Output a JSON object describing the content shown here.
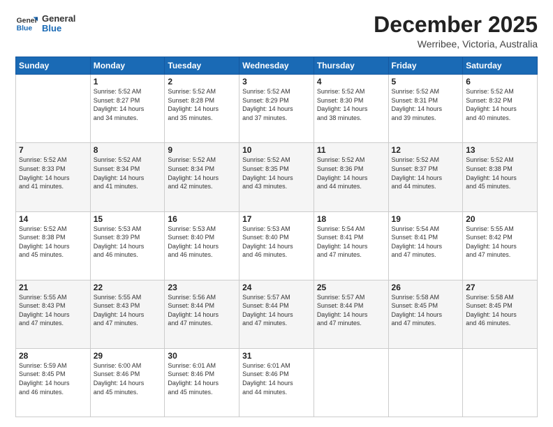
{
  "header": {
    "logo_line1": "General",
    "logo_line2": "Blue",
    "month": "December 2025",
    "location": "Werribee, Victoria, Australia"
  },
  "days_of_week": [
    "Sunday",
    "Monday",
    "Tuesday",
    "Wednesday",
    "Thursday",
    "Friday",
    "Saturday"
  ],
  "weeks": [
    [
      {
        "day": "",
        "info": ""
      },
      {
        "day": "1",
        "info": "Sunrise: 5:52 AM\nSunset: 8:27 PM\nDaylight: 14 hours\nand 34 minutes."
      },
      {
        "day": "2",
        "info": "Sunrise: 5:52 AM\nSunset: 8:28 PM\nDaylight: 14 hours\nand 35 minutes."
      },
      {
        "day": "3",
        "info": "Sunrise: 5:52 AM\nSunset: 8:29 PM\nDaylight: 14 hours\nand 37 minutes."
      },
      {
        "day": "4",
        "info": "Sunrise: 5:52 AM\nSunset: 8:30 PM\nDaylight: 14 hours\nand 38 minutes."
      },
      {
        "day": "5",
        "info": "Sunrise: 5:52 AM\nSunset: 8:31 PM\nDaylight: 14 hours\nand 39 minutes."
      },
      {
        "day": "6",
        "info": "Sunrise: 5:52 AM\nSunset: 8:32 PM\nDaylight: 14 hours\nand 40 minutes."
      }
    ],
    [
      {
        "day": "7",
        "info": "Sunrise: 5:52 AM\nSunset: 8:33 PM\nDaylight: 14 hours\nand 41 minutes."
      },
      {
        "day": "8",
        "info": "Sunrise: 5:52 AM\nSunset: 8:34 PM\nDaylight: 14 hours\nand 41 minutes."
      },
      {
        "day": "9",
        "info": "Sunrise: 5:52 AM\nSunset: 8:34 PM\nDaylight: 14 hours\nand 42 minutes."
      },
      {
        "day": "10",
        "info": "Sunrise: 5:52 AM\nSunset: 8:35 PM\nDaylight: 14 hours\nand 43 minutes."
      },
      {
        "day": "11",
        "info": "Sunrise: 5:52 AM\nSunset: 8:36 PM\nDaylight: 14 hours\nand 44 minutes."
      },
      {
        "day": "12",
        "info": "Sunrise: 5:52 AM\nSunset: 8:37 PM\nDaylight: 14 hours\nand 44 minutes."
      },
      {
        "day": "13",
        "info": "Sunrise: 5:52 AM\nSunset: 8:38 PM\nDaylight: 14 hours\nand 45 minutes."
      }
    ],
    [
      {
        "day": "14",
        "info": "Sunrise: 5:52 AM\nSunset: 8:38 PM\nDaylight: 14 hours\nand 45 minutes."
      },
      {
        "day": "15",
        "info": "Sunrise: 5:53 AM\nSunset: 8:39 PM\nDaylight: 14 hours\nand 46 minutes."
      },
      {
        "day": "16",
        "info": "Sunrise: 5:53 AM\nSunset: 8:40 PM\nDaylight: 14 hours\nand 46 minutes."
      },
      {
        "day": "17",
        "info": "Sunrise: 5:53 AM\nSunset: 8:40 PM\nDaylight: 14 hours\nand 46 minutes."
      },
      {
        "day": "18",
        "info": "Sunrise: 5:54 AM\nSunset: 8:41 PM\nDaylight: 14 hours\nand 47 minutes."
      },
      {
        "day": "19",
        "info": "Sunrise: 5:54 AM\nSunset: 8:41 PM\nDaylight: 14 hours\nand 47 minutes."
      },
      {
        "day": "20",
        "info": "Sunrise: 5:55 AM\nSunset: 8:42 PM\nDaylight: 14 hours\nand 47 minutes."
      }
    ],
    [
      {
        "day": "21",
        "info": "Sunrise: 5:55 AM\nSunset: 8:43 PM\nDaylight: 14 hours\nand 47 minutes."
      },
      {
        "day": "22",
        "info": "Sunrise: 5:55 AM\nSunset: 8:43 PM\nDaylight: 14 hours\nand 47 minutes."
      },
      {
        "day": "23",
        "info": "Sunrise: 5:56 AM\nSunset: 8:44 PM\nDaylight: 14 hours\nand 47 minutes."
      },
      {
        "day": "24",
        "info": "Sunrise: 5:57 AM\nSunset: 8:44 PM\nDaylight: 14 hours\nand 47 minutes."
      },
      {
        "day": "25",
        "info": "Sunrise: 5:57 AM\nSunset: 8:44 PM\nDaylight: 14 hours\nand 47 minutes."
      },
      {
        "day": "26",
        "info": "Sunrise: 5:58 AM\nSunset: 8:45 PM\nDaylight: 14 hours\nand 47 minutes."
      },
      {
        "day": "27",
        "info": "Sunrise: 5:58 AM\nSunset: 8:45 PM\nDaylight: 14 hours\nand 46 minutes."
      }
    ],
    [
      {
        "day": "28",
        "info": "Sunrise: 5:59 AM\nSunset: 8:45 PM\nDaylight: 14 hours\nand 46 minutes."
      },
      {
        "day": "29",
        "info": "Sunrise: 6:00 AM\nSunset: 8:46 PM\nDaylight: 14 hours\nand 45 minutes."
      },
      {
        "day": "30",
        "info": "Sunrise: 6:01 AM\nSunset: 8:46 PM\nDaylight: 14 hours\nand 45 minutes."
      },
      {
        "day": "31",
        "info": "Sunrise: 6:01 AM\nSunset: 8:46 PM\nDaylight: 14 hours\nand 44 minutes."
      },
      {
        "day": "",
        "info": ""
      },
      {
        "day": "",
        "info": ""
      },
      {
        "day": "",
        "info": ""
      }
    ]
  ]
}
